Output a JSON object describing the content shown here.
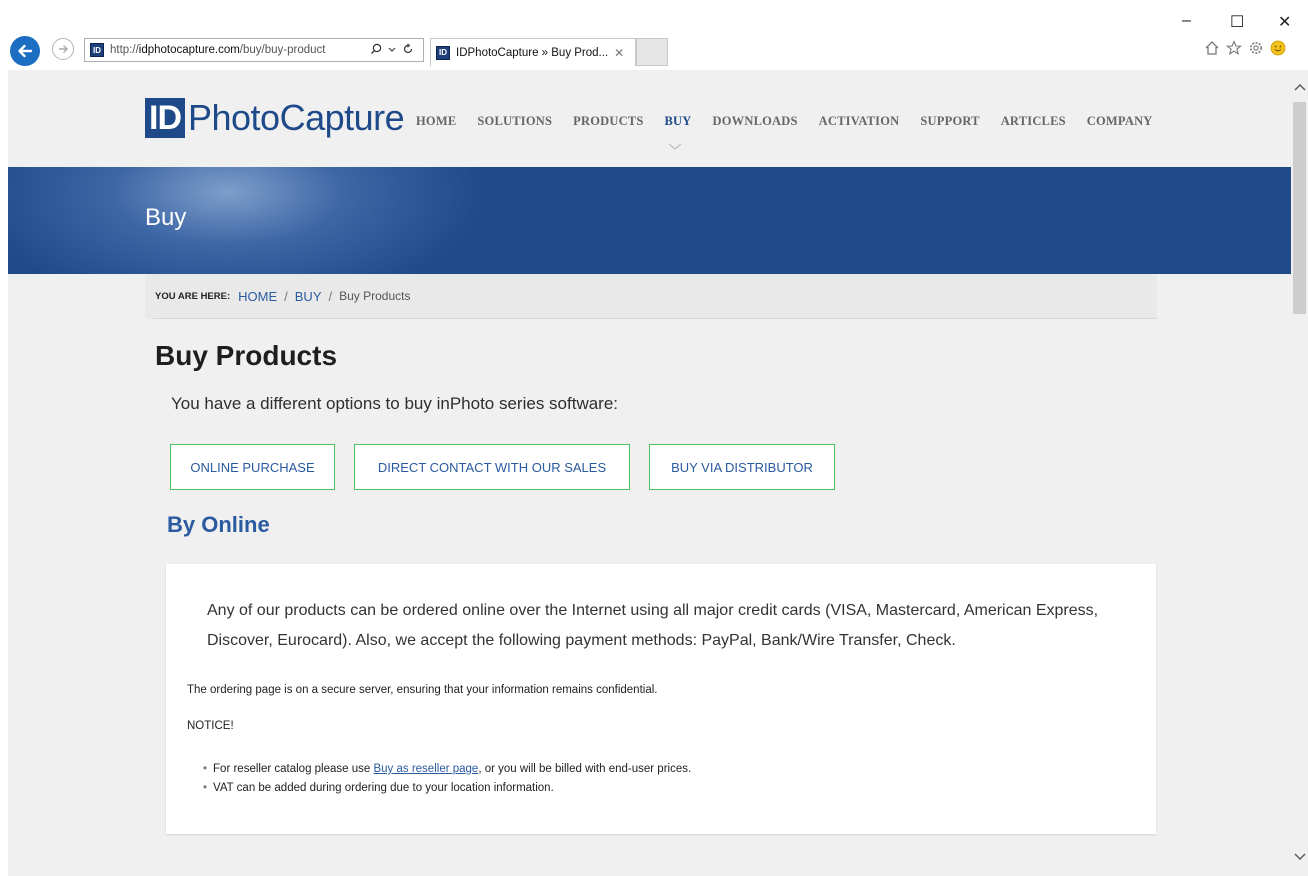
{
  "browser": {
    "url_prefix": "http://",
    "url_host": "idphotocapture.com",
    "url_path": "/buy/buy-product",
    "favicon_text": "ID",
    "tab_title": "IDPhotoCapture » Buy Prod...",
    "tab_close": "✕",
    "window_controls": {
      "minimize": "–",
      "maximize": "☐",
      "close": "✕"
    },
    "icons": [
      "home-icon",
      "star-icon",
      "gear-icon",
      "smiley-icon"
    ]
  },
  "site": {
    "logo_id": "ID",
    "logo_rest": "PhotoCapture",
    "nav": [
      "HOME",
      "SOLUTIONS",
      "PRODUCTS",
      "BUY",
      "DOWNLOADS",
      "ACTIVATION",
      "SUPPORT",
      "ARTICLES",
      "COMPANY"
    ],
    "nav_active": "BUY"
  },
  "banner": {
    "title": "Buy"
  },
  "breadcrumb": {
    "label": "YOU ARE HERE:",
    "home": "HOME",
    "sep1": "/",
    "buy": "BUY",
    "sep2": "/",
    "current": "Buy Products"
  },
  "main": {
    "heading": "Buy Products",
    "intro": "You have a different options to buy inPhoto series software:",
    "options": [
      "ONLINE PURCHASE",
      "DIRECT CONTACT WITH OUR SALES",
      "BUY VIA DISTRIBUTOR"
    ],
    "section_heading": "By Online",
    "paragraph1": "Any of our products can be ordered online over the Internet using all major credit cards (VISA, Mastercard, American Express, Discover, Eurocard). Also, we accept the following payment methods: PayPal, Bank/Wire Transfer, Check.",
    "paragraph2": "The ordering page is on a secure server, ensuring that your information remains confidential.",
    "notice": "NOTICE!",
    "list": {
      "item1_before": "For reseller catalog please use ",
      "item1_link": "Buy as reseller page",
      "item1_after": ", or you will be billed with end-user prices.",
      "item2": "VAT can be added during ordering due to your location information."
    }
  },
  "colors": {
    "brand_blue": "#1f4a8a",
    "link_blue": "#2a5aa0",
    "button_border_green": "#4cc05a",
    "page_bg": "#f0f0f0"
  }
}
